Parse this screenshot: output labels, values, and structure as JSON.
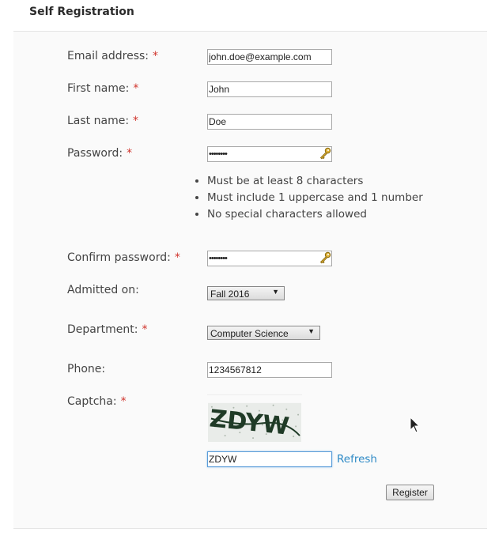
{
  "header": {
    "title": "Self Registration"
  },
  "form": {
    "email": {
      "label": "Email address:",
      "required": "*",
      "value": "john.doe@example.com"
    },
    "first_name": {
      "label": "First name:",
      "required": "*",
      "value": "John"
    },
    "last_name": {
      "label": "Last name:",
      "required": "*",
      "value": "Doe"
    },
    "password": {
      "label": "Password:",
      "required": "*",
      "value": "••••••••",
      "icon": "key-icon"
    },
    "password_rules": [
      "Must be at least 8 characters",
      "Must include 1 uppercase and 1 number",
      "No special characters allowed"
    ],
    "confirm_password": {
      "label": "Confirm password:",
      "required": "*",
      "value": "••••••••",
      "icon": "key-icon"
    },
    "admitted_on": {
      "label": "Admitted on:",
      "selected": "Fall 2016"
    },
    "department": {
      "label": "Department:",
      "required": "*",
      "selected": "Computer Science"
    },
    "phone": {
      "label": "Phone:",
      "value": "1234567812"
    },
    "captcha": {
      "label": "Captcha:",
      "required": "*",
      "image_text": "ZDYW",
      "value": "ZDYW",
      "refresh_label": "Refresh"
    },
    "register_label": "Register"
  },
  "colors": {
    "required": "#d0342c",
    "link": "#2e8ac6",
    "focus": "#5b9dd9"
  }
}
